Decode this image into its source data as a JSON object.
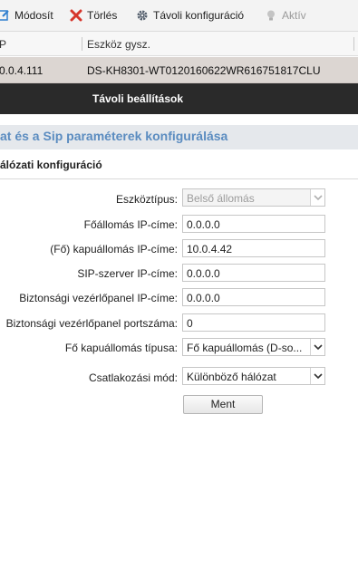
{
  "toolbar": {
    "edit_label": "Módosít",
    "delete_label": "Törlés",
    "remote_config_label": "Távoli konfiguráció",
    "active_label": "Aktív"
  },
  "table": {
    "columns": [
      "P",
      "Eszköz gysz."
    ],
    "rows": [
      {
        "ip": "0.0.4.111",
        "serial": "DS-KH8301-WT0120160622WR616751817CLU"
      }
    ]
  },
  "dialog": {
    "title": "Távoli beállítások",
    "section_title": "at és a Sip paraméterek konfigurálása",
    "subsection_title": "álózati konfiguráció"
  },
  "form": {
    "device_type": {
      "label": "Eszköztípus:",
      "value": "Belső állomás"
    },
    "master_ip": {
      "label": "Főállomás IP-címe:",
      "value": "0.0.0.0"
    },
    "gateway_ip": {
      "label": "(Fő) kapuállomás IP-címe:",
      "value": "10.0.4.42"
    },
    "sip_ip": {
      "label": "SIP-szerver IP-címe:",
      "value": "0.0.0.0"
    },
    "security_ip": {
      "label": "Biztonsági vezérlőpanel IP-címe:",
      "value": "0.0.0.0"
    },
    "security_port": {
      "label": "Biztonsági vezérlőpanel portszáma:",
      "value": "0"
    },
    "gateway_type": {
      "label": "Fő kapuállomás típusa:",
      "value": "Fő kapuállomás (D-so..."
    },
    "connection_mode": {
      "label": "Csatlakozási mód:",
      "value": "Különböző hálózat"
    },
    "save_label": "Ment"
  },
  "colors": {
    "section_title": "#5b8cc0",
    "title_bar": "#2a2a2a",
    "selected_row": "#dcd6d2"
  }
}
